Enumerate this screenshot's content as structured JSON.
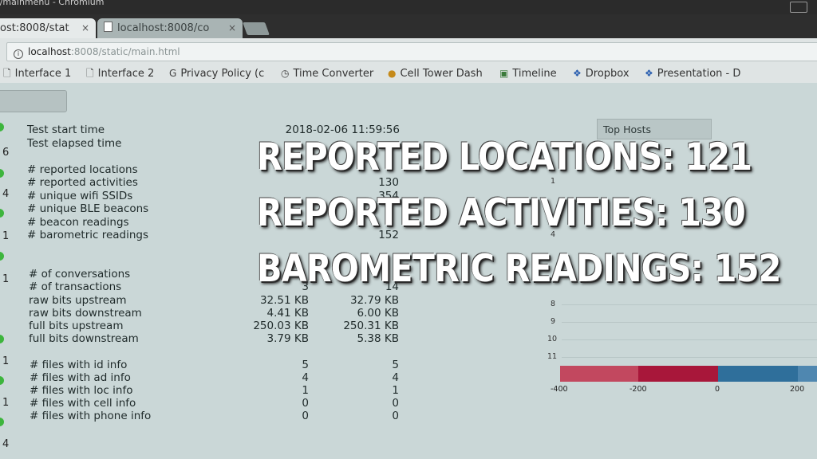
{
  "window": {
    "title": "s/mainmenu - Chromium"
  },
  "tabs": [
    {
      "label": "ost:8008/stat",
      "close": "×"
    },
    {
      "label": "localhost:8008/co",
      "close": "×"
    }
  ],
  "address": {
    "host": "localhost",
    "path": ":8008/static/main.html"
  },
  "bookmarks": [
    {
      "label": "Interface 1",
      "icon": "page-icon"
    },
    {
      "label": "Interface 2",
      "icon": "page-icon"
    },
    {
      "label": "Privacy Policy (c",
      "icon": "google-icon"
    },
    {
      "label": "Time Converter",
      "icon": "clock-icon"
    },
    {
      "label": "Cell Tower Dash",
      "icon": "cell-icon"
    },
    {
      "label": "Timeline",
      "icon": "timeline-icon"
    },
    {
      "label": "Dropbox",
      "icon": "dropbox-icon"
    },
    {
      "label": "Presentation - D",
      "icon": "dropbox-icon"
    }
  ],
  "side_numbers": [
    "6",
    "4",
    "1",
    "1",
    "1",
    "1",
    "4"
  ],
  "stats": {
    "start_time": {
      "label": "Test start time",
      "v1": "2018-02-06 11:59:56"
    },
    "elapsed": {
      "label": "Test elapsed time"
    },
    "locations": {
      "label": "# reported locations"
    },
    "activities": {
      "label": "# reported activities",
      "v1": "130"
    },
    "wifi": {
      "label": "# unique wifi SSIDs",
      "v1": "354"
    },
    "ble": {
      "label": "# unique BLE beacons"
    },
    "beacon": {
      "label": "# beacon readings"
    },
    "barometric": {
      "label": "# barometric readings",
      "v1": "152"
    },
    "conversations": {
      "label": "# of conversations"
    },
    "transactions": {
      "label": "# of transactions",
      "v1": "3",
      "v2": "14"
    },
    "raw_up": {
      "label": "raw bits upstream",
      "v1": "32.51 KB",
      "v2": "32.79 KB"
    },
    "raw_down": {
      "label": "raw bits downstream",
      "v1": "4.41 KB",
      "v2": "6.00 KB"
    },
    "full_up": {
      "label": "full bits upstream",
      "v1": "250.03 KB",
      "v2": "250.31 KB"
    },
    "full_down": {
      "label": "full bits downstream",
      "v1": "3.79 KB",
      "v2": "5.38 KB"
    },
    "files_id": {
      "label": "# files with id info",
      "v1": "5",
      "v2": "5"
    },
    "files_ad": {
      "label": "# files with ad info",
      "v1": "4",
      "v2": "4"
    },
    "files_loc": {
      "label": "# files with loc info",
      "v1": "1",
      "v2": "1"
    },
    "files_cell": {
      "label": "# files with cell info",
      "v1": "0",
      "v2": "0"
    },
    "files_phone": {
      "label": "# files with phone info",
      "v1": "0",
      "v2": "0"
    }
  },
  "top_hosts": {
    "button_label": "Top Hosts",
    "row_labels": [
      "1",
      "4",
      "8",
      "9",
      "10",
      "11"
    ],
    "axis_ticks": [
      "-400",
      "-200",
      "0",
      "200"
    ],
    "bar_colors": [
      "#c2485f",
      "#a8173a",
      "#2f6f9b",
      "#4f87b0"
    ]
  },
  "overlay": {
    "line1": "REPORTED LOCATIONS: 121",
    "line2": "REPORTED ACTIVITIES: 130",
    "line3": "BAROMETRIC READINGS: 152"
  }
}
